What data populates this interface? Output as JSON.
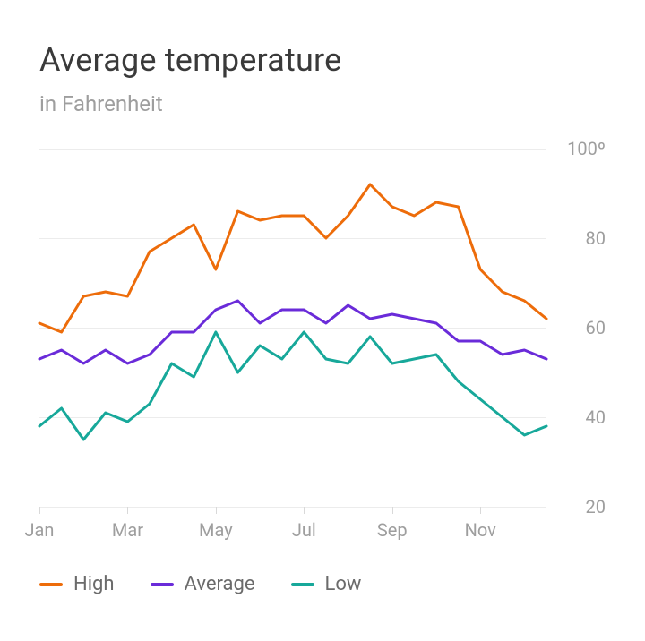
{
  "title": "Average temperature",
  "subtitle": "in Fahrenheit",
  "chart_data": {
    "type": "line",
    "xlabel": "",
    "ylabel": "",
    "ylim": [
      20,
      100
    ],
    "yticks": [
      20,
      40,
      60,
      80,
      100
    ],
    "ytick_labels": [
      "20",
      "40",
      "60",
      "80",
      "100º"
    ],
    "x_count": 24,
    "xticks": [
      0,
      4,
      8,
      12,
      16,
      20
    ],
    "xtick_labels": [
      "Jan",
      "Mar",
      "May",
      "Jul",
      "Sep",
      "Nov"
    ],
    "series": [
      {
        "name": "High",
        "color": "#ed6c0a",
        "legend_label": "High",
        "values": [
          61,
          59,
          67,
          68,
          67,
          77,
          80,
          83,
          73,
          86,
          84,
          85,
          85,
          80,
          85,
          92,
          87,
          85,
          88,
          87,
          73,
          68,
          66,
          62
        ]
      },
      {
        "name": "Average",
        "color": "#6a2bd9",
        "legend_label": "Average",
        "values": [
          53,
          55,
          52,
          55,
          52,
          54,
          59,
          59,
          64,
          66,
          61,
          64,
          64,
          61,
          65,
          62,
          63,
          62,
          61,
          57,
          57,
          54,
          55,
          53
        ]
      },
      {
        "name": "Low",
        "color": "#17a89a",
        "legend_label": "Low",
        "values": [
          38,
          42,
          35,
          41,
          39,
          43,
          52,
          49,
          59,
          50,
          56,
          53,
          59,
          53,
          52,
          58,
          52,
          53,
          54,
          48,
          44,
          40,
          36,
          38
        ]
      }
    ]
  }
}
